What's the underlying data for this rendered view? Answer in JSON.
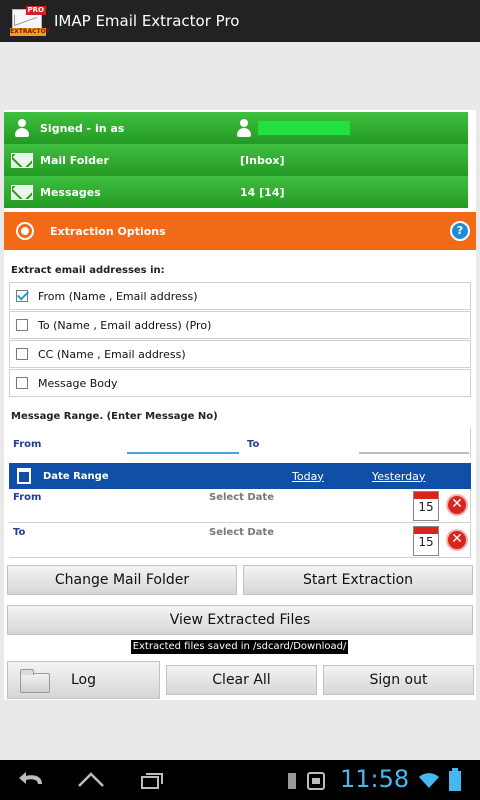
{
  "app": {
    "title": "IMAP Email Extractor Pro",
    "icon_badge": "PRO",
    "icon_tag": "EXTRACTOR"
  },
  "account": {
    "signed_in_label": "Signed - in as",
    "mail_folder_label": "Mail Folder",
    "mail_folder_value": "[Inbox]",
    "messages_label": "Messages",
    "messages_value": "14 [14]"
  },
  "extraction": {
    "header": "Extraction Options",
    "help_glyph": "?",
    "extract_in_label": "Extract email addresses in:",
    "options": [
      {
        "label": "From (Name , Email address)",
        "checked": true
      },
      {
        "label": "To (Name , Email address) (Pro)",
        "checked": false
      },
      {
        "label": "CC (Name , Email address)",
        "checked": false
      },
      {
        "label": "Message Body",
        "checked": false
      }
    ],
    "message_range_label": "Message Range. (Enter Message No)",
    "range_from_label": "From",
    "range_to_label": "To"
  },
  "date_range": {
    "header": "Date Range",
    "today_link": "Today",
    "yesterday_link": "Yesterday",
    "from_label": "From",
    "to_label": "To",
    "placeholder": "Select Date",
    "calendar_day": "15",
    "clear_glyph": "✕"
  },
  "buttons": {
    "change_folder": "Change Mail Folder",
    "start_extraction": "Start Extraction",
    "view_files": "View Extracted Files",
    "log": "Log",
    "clear_all": "Clear All",
    "sign_out": "Sign out"
  },
  "notice": "Extracted files saved in /sdcard/Download/",
  "status": {
    "time": "11:58"
  },
  "colors": {
    "green": "#2eaa2e",
    "orange": "#f26a16",
    "blue": "#0f4fa8",
    "clock": "#47b8ef"
  },
  "icons": [
    "person-icon",
    "mail-icon",
    "target-icon",
    "help-icon",
    "calendar-icon",
    "clear-icon",
    "folder-icon",
    "back-icon",
    "home-icon",
    "recents-icon",
    "wifi-icon",
    "battery-icon"
  ]
}
